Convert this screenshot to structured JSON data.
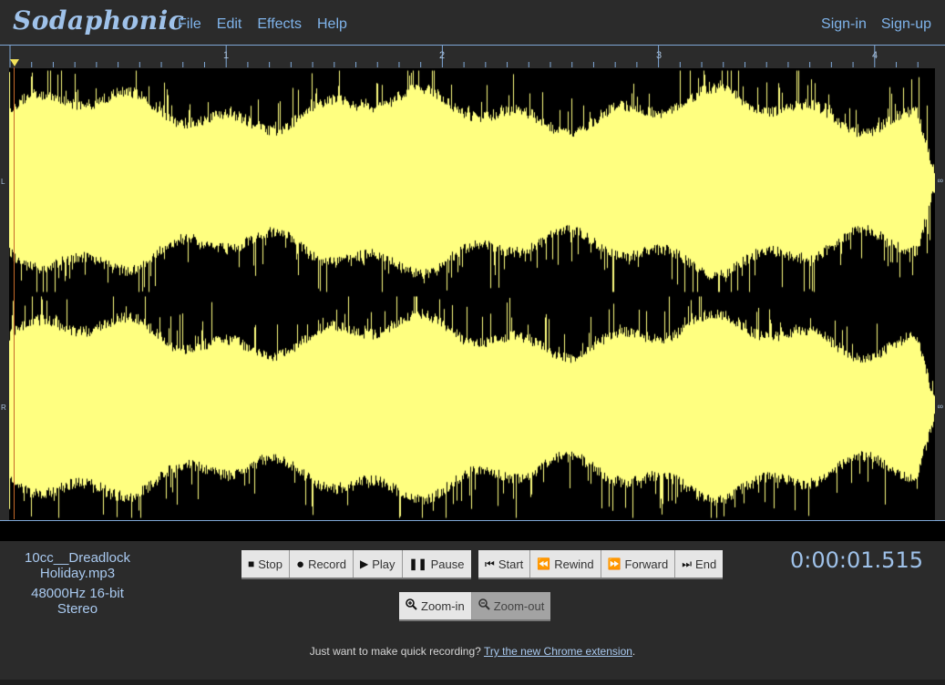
{
  "header": {
    "logo": "Sodaphonic",
    "menu": [
      "File",
      "Edit",
      "Effects",
      "Help"
    ],
    "auth": {
      "signin": "Sign-in",
      "signup": "Sign-up"
    }
  },
  "timeline": {
    "ticks": [
      "1",
      "2",
      "3",
      "4"
    ]
  },
  "channels": {
    "left": "L",
    "right": "R",
    "left_end": "∞",
    "right_end": "∞"
  },
  "file_info": {
    "name_line1": "10cc__Dreadlock",
    "name_line2": "Holiday.mp3",
    "format_line1": "48000Hz 16-bit",
    "format_line2": "Stereo"
  },
  "transport": {
    "stop": "Stop",
    "record": "Record",
    "play": "Play",
    "pause": "Pause",
    "start": "Start",
    "rewind": "Rewind",
    "forward": "Forward",
    "end": "End",
    "zoom_in": "Zoom-in",
    "zoom_out": "Zoom-out"
  },
  "clock": "0:00:01.515",
  "footer": {
    "text": "Just want to make quick recording?",
    "link": "Try the new Chrome extension",
    "tail": "."
  },
  "colors": {
    "waveform": "#ffff80",
    "accent": "#7fb3ea",
    "background": "#2b2b2b"
  }
}
